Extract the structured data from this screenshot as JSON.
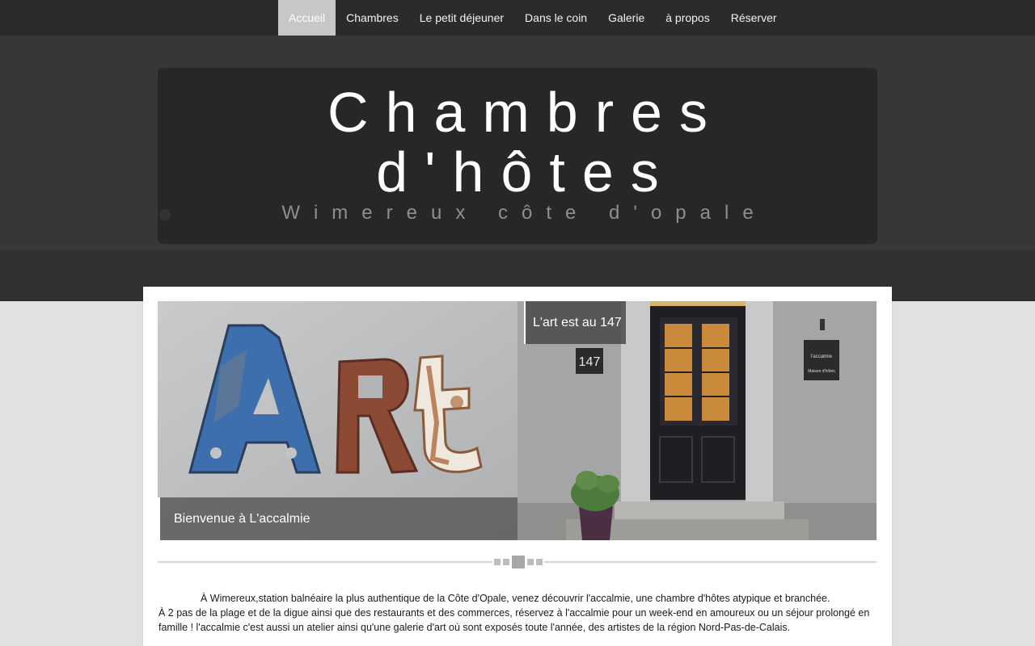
{
  "nav": {
    "items": [
      {
        "label": "Accueil",
        "active": true
      },
      {
        "label": "Chambres"
      },
      {
        "label": "Le petit déjeuner"
      },
      {
        "label": "Dans le coin"
      },
      {
        "label": "Galerie"
      },
      {
        "label": "à propos"
      },
      {
        "label": "Réserver"
      }
    ]
  },
  "hero": {
    "title_line1": "Chambres",
    "title_line2": "d'hôtes",
    "subtitle": "Wimereux côte d'opale"
  },
  "slides": {
    "left_caption": "Bienvenue à L'accalmie",
    "right_caption": "L'art est au 147",
    "art_letters": "ARt",
    "house_number": "147",
    "house_sign_line1": "l'accalmie",
    "house_sign_line2": "Maison d'hôtes"
  },
  "intro": {
    "line1": "À Wimereux,station balnéaire la plus authentique de la Côte d'Opale, venez découvrir l'accalmie, une chambre d'hôtes atypique et branchée.",
    "line2": "À 2 pas de la plage et de la digue ainsi que des restaurants et des commerces, réservez à l'accalmie pour un week-end en amoureux ou un séjour prolongé en famille ! l'accalmie c'est aussi un atelier ainsi qu'une galerie d'art où sont exposés toute l'année, des artistes de la région Nord-Pas-de-Calais."
  },
  "colors": {
    "nav_bg": "#2b2b2b",
    "nav_active_bg": "#c7c7c7",
    "hero_bg": "#373737",
    "hero_box_bg": "#272727",
    "page_bg": "#e2e1df"
  }
}
